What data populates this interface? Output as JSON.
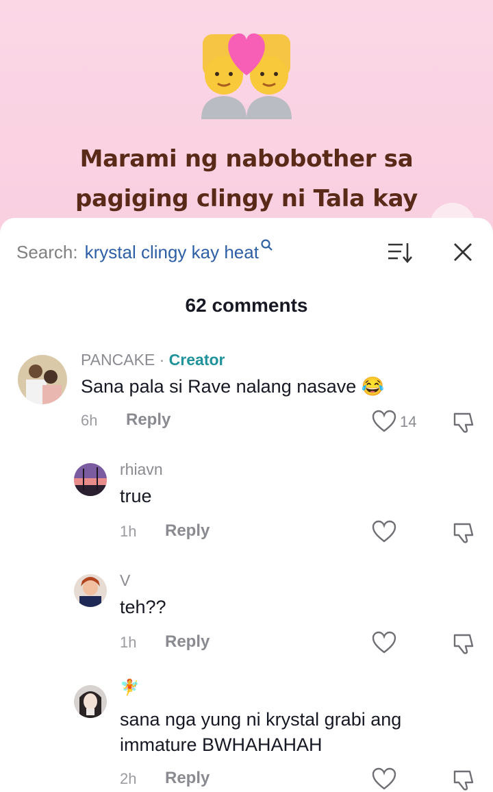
{
  "video": {
    "headline_line1": "Marami ng nabobother sa",
    "headline_line2": "pagiging clingy ni Tala kay",
    "emoji_name": "couple-with-heart"
  },
  "search": {
    "label": "Search:",
    "query": "krystal clingy kay heat",
    "icon": "search-icon"
  },
  "comments_count": "62 comments",
  "comments": [
    {
      "username": "PANCAKE",
      "separator": " · ",
      "badge": "Creator",
      "text": "Sana pala si Rave nalang nasave 😂",
      "time": "6h",
      "reply": "Reply",
      "likes": "14"
    },
    {
      "username": "rhiavn",
      "text": "true",
      "time": "1h",
      "reply": "Reply"
    },
    {
      "username": "V",
      "text": "teh??",
      "time": "1h",
      "reply": "Reply"
    },
    {
      "username": "🧚",
      "text_line1": "sana nga yung ni krystal grabi ang",
      "text_line2": "immature BWHAHAHAH",
      "time": "2h",
      "reply": "Reply"
    }
  ],
  "colors": {
    "accent_link": "#2d5fa6",
    "creator_badge": "#20929a",
    "headline": "#5a2a18"
  }
}
